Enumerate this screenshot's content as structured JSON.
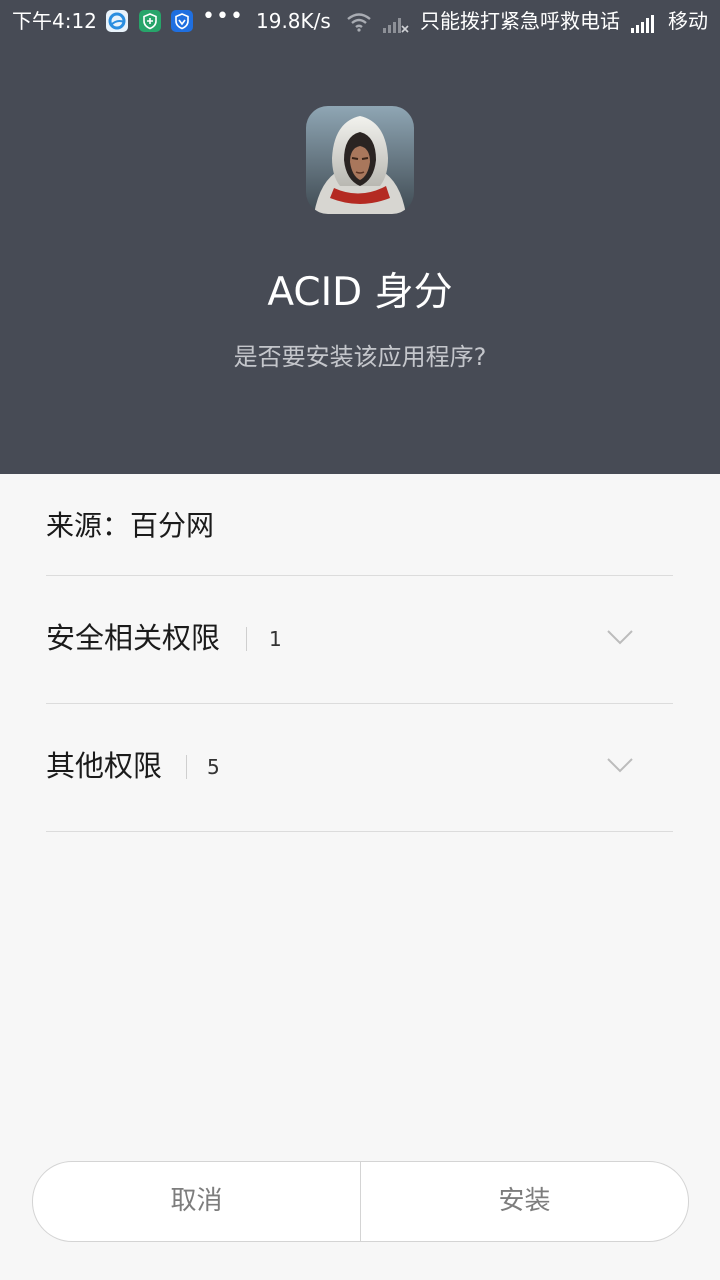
{
  "status_bar": {
    "time": "下午4:12",
    "more": "•••",
    "net_speed": "19.8K/s",
    "emergency": "只能拨打紧急呼救电话",
    "carrier": "移动",
    "notification_icons": [
      "browser-icon",
      "shield-icon",
      "security-icon"
    ]
  },
  "app": {
    "name": "ACID 身分",
    "prompt": "是否要安装该应用程序?"
  },
  "source": {
    "text": "来源：百分网"
  },
  "permissions": [
    {
      "label": "安全相关权限",
      "count": "1"
    },
    {
      "label": "其他权限",
      "count": "5"
    }
  ],
  "buttons": {
    "cancel": "取消",
    "install": "安装"
  },
  "colors": {
    "header_bg": "#474b55",
    "body_bg": "#f7f7f7",
    "progress": "#64c214"
  }
}
